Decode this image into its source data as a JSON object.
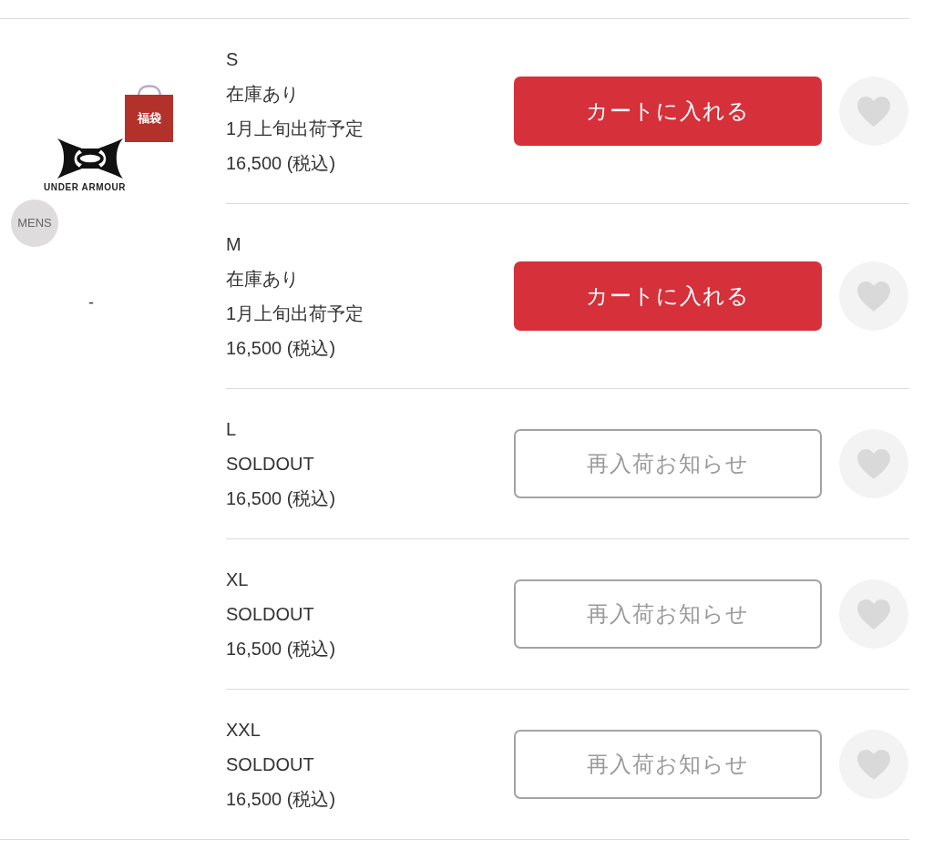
{
  "product": {
    "image": {
      "bag_label": "福袋",
      "brand": "UNDER ARMOUR",
      "badge": "MENS"
    },
    "note": "-"
  },
  "variants": [
    {
      "size": "S",
      "stock": "在庫あり",
      "shipping": "1月上旬出荷予定",
      "price": "16,500 (税込)",
      "button": {
        "kind": "cart",
        "label": "カートに入れる"
      },
      "favorited": false
    },
    {
      "size": "M",
      "stock": "在庫あり",
      "shipping": "1月上旬出荷予定",
      "price": "16,500 (税込)",
      "button": {
        "kind": "cart",
        "label": "カートに入れる"
      },
      "favorited": false
    },
    {
      "size": "L",
      "stock": "SOLDOUT",
      "price": "16,500 (税込)",
      "button": {
        "kind": "notify",
        "label": "再入荷お知らせ"
      },
      "favorited": false
    },
    {
      "size": "XL",
      "stock": "SOLDOUT",
      "price": "16,500 (税込)",
      "button": {
        "kind": "notify",
        "label": "再入荷お知らせ"
      },
      "favorited": false
    },
    {
      "size": "XXL",
      "stock": "SOLDOUT",
      "price": "16,500 (税込)",
      "button": {
        "kind": "notify",
        "label": "再入荷お知らせ"
      },
      "favorited": false
    }
  ]
}
